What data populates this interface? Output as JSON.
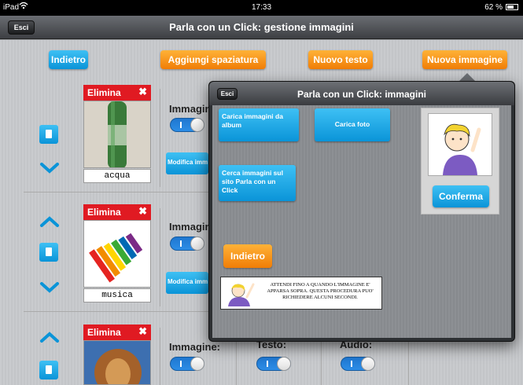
{
  "status_bar": {
    "device": "iPad",
    "time": "17:33",
    "battery": "62 %"
  },
  "nav": {
    "exit_label": "Esci",
    "title": "Parla con un Click: gestione immagini"
  },
  "toolbar": {
    "back_label": "Indietro",
    "add_spacing_label": "Aggiungi spaziatura",
    "new_text_label": "Nuovo testo",
    "new_image_label": "Nuova immagine"
  },
  "rows": [
    {
      "delete_label": "Elimina",
      "caption": "acqua",
      "image_label": "Immagin",
      "edit_label": "Modifica imm"
    },
    {
      "delete_label": "Elimina",
      "caption": "musica",
      "image_label": "Immagin",
      "edit_label": "Modifica imm"
    },
    {
      "delete_label": "Elimina",
      "image_label": "Immagine:",
      "text_label": "Testo:",
      "audio_label": "Audio:"
    }
  ],
  "popup": {
    "exit_label": "Esci",
    "title": "Parla con un Click: immagini",
    "load_album_label": "Carica immagini da album",
    "load_photo_label": "Carica foto",
    "search_site_label": "Cerca immagini sul sito Parla con un Click",
    "confirm_label": "Conferma",
    "back_label": "Indietro",
    "notice_text": "ATTENDI FINO A QUANDO L'IMMAGINE E' APPARSA SOPRA. QUESTA PROCEDURA PUO' RICHIEDERE ALCUNI SECONDI."
  },
  "colors": {
    "blue": "#0a94d8",
    "orange": "#f07d06",
    "red": "#e01a22",
    "switch_blue": "#1f77d0"
  },
  "icons": [
    "wifi-icon",
    "battery-icon",
    "chevron-up-icon",
    "chevron-down-icon",
    "document-icon",
    "delete-x-icon"
  ]
}
